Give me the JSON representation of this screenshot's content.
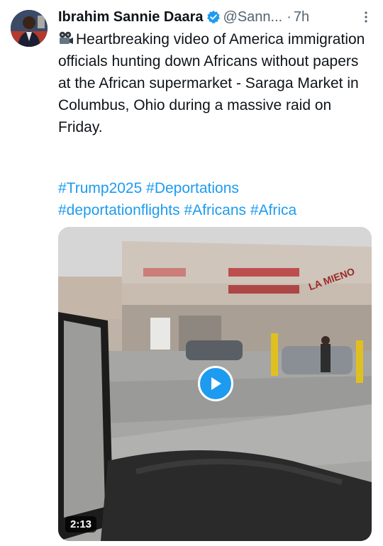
{
  "post": {
    "author_name": "Ibrahim Sannie Daara",
    "handle": "@Sann...",
    "separator": "·",
    "time": "7h",
    "more_icon": "more-vertical-icon",
    "film_icon": "film-projector-icon",
    "text": "Heartbreaking video of America immigration officials hunting down Africans without papers at the African supermarket - Saraga Market in Columbus, Ohio during a massive raid on Friday.",
    "hashtags": [
      "#Trump2025",
      "#Deportations",
      "#deportationflights",
      "#Africans",
      "#Africa"
    ]
  },
  "media": {
    "duration": "2:13",
    "play_icon": "play-icon",
    "sign_left": "",
    "sign_main": "",
    "sign_right": "LA MIENO"
  },
  "colors": {
    "link": "#1d9bf0",
    "verified": "#1d9bf0",
    "secondary_text": "#536471",
    "text": "#0f1419"
  }
}
